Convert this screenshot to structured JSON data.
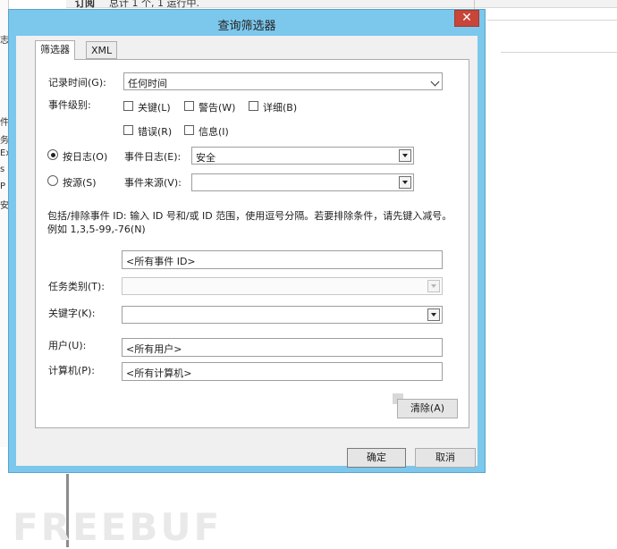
{
  "background": {
    "top_text_1": "订阅",
    "top_text_2": "总计 1 个, 1 运行中.",
    "left_chars": [
      "志",
      "件",
      "务",
      "Ex",
      "s",
      "P",
      "安"
    ],
    "watermark": "FREEBUF"
  },
  "dialog": {
    "title": "查询筛选器",
    "close_label": "✕",
    "tabs": [
      {
        "label": "筛选器",
        "active": true
      },
      {
        "label": "XML",
        "active": false
      }
    ],
    "logged": {
      "label": "记录时间(G):",
      "value": "任何时间"
    },
    "event_level": {
      "label": "事件级别:",
      "options": [
        {
          "label": "关键(L)",
          "checked": false
        },
        {
          "label": "警告(W)",
          "checked": false
        },
        {
          "label": "详细(B)",
          "checked": false
        },
        {
          "label": "错误(R)",
          "checked": false
        },
        {
          "label": "信息(I)",
          "checked": false
        }
      ]
    },
    "by_log": {
      "radio_label": "按日志(O)",
      "selected": true,
      "field_label": "事件日志(E):",
      "value": "安全"
    },
    "by_source": {
      "radio_label": "按源(S)",
      "selected": false,
      "field_label": "事件来源(V):",
      "value": ""
    },
    "event_id_desc": "包括/排除事件 ID: 输入 ID 号和/或 ID 范围，使用逗号分隔。若要排除条件，请先键入减号。例如 1,3,5-99,-76(N)",
    "event_id_value": "<所有事件 ID>",
    "task_category": {
      "label": "任务类别(T):",
      "value": ""
    },
    "keywords": {
      "label": "关键字(K):",
      "value": ""
    },
    "user": {
      "label": "用户(U):",
      "value": "<所有用户>"
    },
    "computer": {
      "label": "计算机(P):",
      "value": "<所有计算机>"
    },
    "clear_button": "清除(A)",
    "ok_button": "确定",
    "cancel_button": "取消"
  }
}
